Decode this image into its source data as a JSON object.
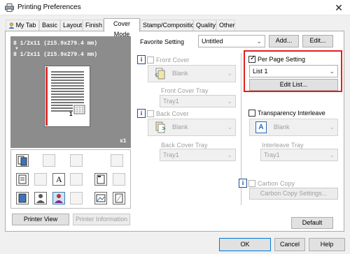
{
  "window": {
    "title": "Printing Preferences",
    "close_symbol": "✕"
  },
  "tabs": [
    {
      "label": "My Tab",
      "active": false
    },
    {
      "label": "Basic",
      "active": false
    },
    {
      "label": "Layout",
      "active": false
    },
    {
      "label": "Finish",
      "active": false
    },
    {
      "label": "Cover Mode",
      "active": true
    },
    {
      "label": "Stamp/Composition",
      "active": false
    },
    {
      "label": "Quality",
      "active": false
    },
    {
      "label": "Other",
      "active": false
    }
  ],
  "preview": {
    "paper_line1": "8 1/2x11 (215.9x279.4 mm)",
    "paper_line2": "8 1/2x11 (215.9x279.4 mm)",
    "arrow": "▼",
    "page_number": "1",
    "copies": "x1",
    "printer_view_label": "Printer View",
    "printer_information_label": "Printer Information"
  },
  "favorite": {
    "label": "Favorite Setting",
    "value": "Untitled",
    "add_label": "Add...",
    "edit_label": "Edit..."
  },
  "front_cover": {
    "label": "Front Cover",
    "value": "Blank",
    "tray_label": "Front Cover Tray",
    "tray_value": "Tray1"
  },
  "back_cover": {
    "label": "Back Cover",
    "value": "Blank",
    "tray_label": "Back Cover Tray",
    "tray_value": "Tray1"
  },
  "per_page": {
    "label": "Per Page Setting",
    "checked": true,
    "value": "List 1",
    "edit_list_label": "Edit List..."
  },
  "transparency": {
    "label": "Transparency Interleave",
    "value": "Blank",
    "tray_label": "Interleave Tray",
    "tray_value": "Tray1"
  },
  "carbon_copy": {
    "label": "Carbon Copy",
    "settings_label": "Carbon Copy Settings..."
  },
  "default_label": "Default",
  "footer": {
    "ok_label": "OK",
    "cancel_label": "Cancel",
    "help_label": "Help"
  },
  "colors": {
    "highlight_border": "#e02020",
    "preview_bg": "#8c8c8c",
    "accent": "#3c7fb1"
  },
  "icons": {
    "info": "i",
    "chevron": "⌄"
  }
}
